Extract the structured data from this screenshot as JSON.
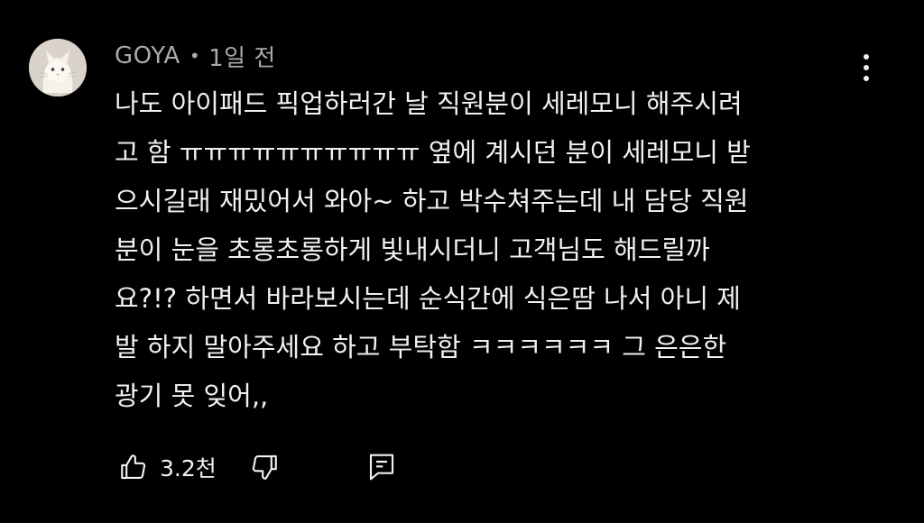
{
  "comment": {
    "author": "GOYA",
    "separator": "•",
    "timestamp": "1일 전",
    "text": "나도 아이패드 픽업하러간 날 직원분이 세레모니 해주시려\n고 함 ㅠㅠㅠㅠㅠㅠㅠㅠㅠㅠ 옆에 계시던 분이 세레모니 받\n으시길래 재밌어서 와아~ 하고 박수쳐주는데 내 담당 직원\n분이 눈을 초롱초롱하게 빛내시더니 고객님도 해드릴까\n요?!? 하면서 바라보시는데 순식간에 식은땀 나서 아니 제\n발 하지 말아주세요 하고 부탁함 ㅋㅋㅋㅋㅋㅋ 그 은은한\n광기 못 잊어,,",
    "avatar_icon": "cat-avatar-icon",
    "menu_icon": "more-vertical-icon"
  },
  "actions": {
    "like_icon": "thumbs-up-icon",
    "like_count": "3.2천",
    "dislike_icon": "thumbs-down-icon",
    "reply_icon": "comment-reply-icon"
  },
  "colors": {
    "background": "#000000",
    "text_primary": "#f1f1f1",
    "text_secondary": "#aaaaaa"
  }
}
